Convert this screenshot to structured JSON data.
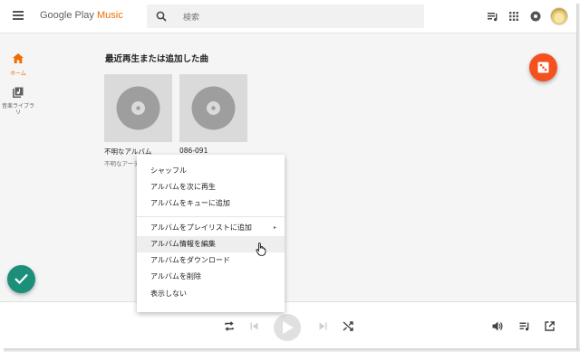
{
  "app": {
    "logo_main": "Google Play ",
    "logo_accent": "Music"
  },
  "search": {
    "placeholder": "検索"
  },
  "nav": {
    "home_label": "ホーム",
    "library_label": "音楽ライブラリ"
  },
  "section": {
    "title": "最近再生または追加した曲"
  },
  "cards": [
    {
      "title": "不明なアルバム",
      "subtitle": "不明なアーティスト"
    },
    {
      "title": "086-091",
      "subtitle": ""
    }
  ],
  "context_menu": {
    "items": [
      {
        "label": "シャッフル"
      },
      {
        "label": "アルバムを次に再生"
      },
      {
        "label": "アルバムをキューに追加"
      },
      {
        "label": "アルバムをプレイリストに追加",
        "submenu_arrow": "▸"
      },
      {
        "label": "アルバム情報を編集"
      },
      {
        "label": "アルバムをダウンロード"
      },
      {
        "label": "アルバムを削除"
      },
      {
        "label": "表示しない"
      }
    ],
    "hovered_item": "アルバム情報を編集"
  },
  "colors": {
    "accent": "#ef6c00",
    "shuffle_fab": "#f4511e",
    "check_fab": "#1b8f7a",
    "main_bg": "#f5f5f5"
  },
  "icons": {
    "menu": "hamburger-menu-icon",
    "search": "search-icon",
    "queue": "queue-music-icon",
    "apps": "apps-grid-icon",
    "notifications": "circle-badge-icon",
    "home": "home-icon",
    "library": "library-music-icon",
    "shuffle_fab": "dice-icon",
    "check_fab": "check-icon",
    "repeat": "repeat-icon",
    "previous": "skip-previous-icon",
    "play": "play-icon",
    "next": "skip-next-icon",
    "shuffle": "shuffle-icon",
    "volume": "volume-icon",
    "queue_player": "queue-icon",
    "open_external": "open-in-new-icon"
  }
}
